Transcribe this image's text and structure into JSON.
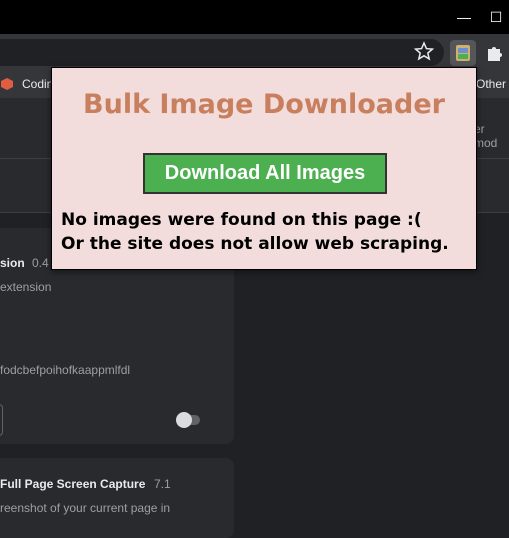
{
  "window": {
    "minimize_glyph": "—",
    "maximize_glyph": "☐"
  },
  "toolbar": {
    "star_icon": "star-icon",
    "extension_icon": "bulk-image-downloader-icon",
    "extensions_menu_icon": "puzzle-icon"
  },
  "bookmarks": {
    "item_label": "Codin",
    "other_label": "Other"
  },
  "header": {
    "dev_mode_partial": "er mod"
  },
  "extensions": [
    {
      "name_partial": "sion",
      "version_partial": "0.4",
      "description_partial": "extension",
      "id_partial": "fodcbefpoihofkaappmlfdl",
      "enabled": false
    },
    {
      "name": "Full Page Screen Capture",
      "version": "7.1",
      "description_partial": "reenshot of your current page in"
    }
  ],
  "popup": {
    "title": "Bulk Image Downloader",
    "download_button_label": "Download All Images",
    "message_line1": "No images were found on this page :(",
    "message_line2": "Or the site does not allow web scraping."
  },
  "colors": {
    "popup_bg": "#f2dddc",
    "title": "#c87f5e",
    "button": "#4caf50"
  }
}
